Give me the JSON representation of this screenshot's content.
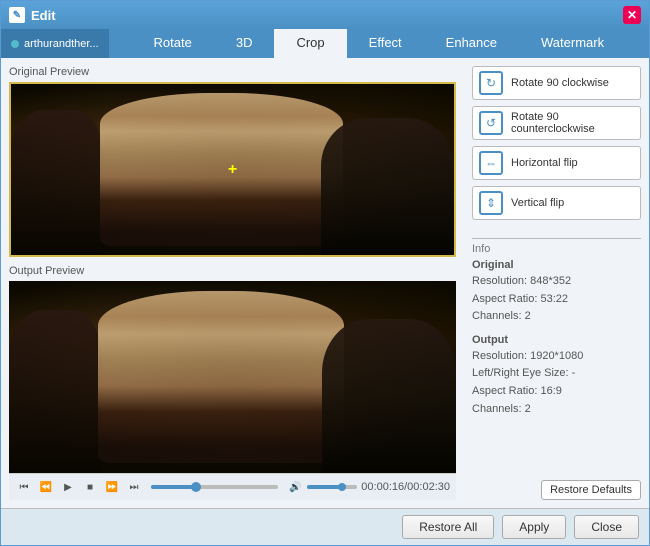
{
  "window": {
    "title": "Edit",
    "icon": "✎"
  },
  "tabs": {
    "file_tab": "arthurandther...",
    "items": [
      "Rotate",
      "3D",
      "Crop",
      "Effect",
      "Enhance",
      "Watermark"
    ],
    "active": "Crop"
  },
  "panels": {
    "original_label": "Original Preview",
    "output_label": "Output Preview"
  },
  "actions": [
    {
      "id": "rotate-cw",
      "icon": "↻",
      "label": "Rotate 90 clockwise"
    },
    {
      "id": "rotate-ccw",
      "icon": "↺",
      "label": "Rotate 90 counterclockwise"
    },
    {
      "id": "flip-h",
      "icon": "⇔",
      "label": "Horizontal flip"
    },
    {
      "id": "flip-v",
      "icon": "⇕",
      "label": "Vertical flip"
    }
  ],
  "info": {
    "section_label": "Info",
    "original_label": "Original",
    "original_resolution": "Resolution: 848*352",
    "original_aspect": "Aspect Ratio: 53:22",
    "original_channels": "Channels: 2",
    "output_label": "Output",
    "output_resolution": "Resolution: 1920*1080",
    "output_lr_size": "Left/Right Eye Size: -",
    "output_aspect": "Aspect Ratio: 16:9",
    "output_channels": "Channels: 2"
  },
  "controls": {
    "time_display": "00:00:16/00:02:30",
    "restore_defaults_label": "Restore Defaults"
  },
  "bottom": {
    "restore_all_label": "Restore All",
    "apply_label": "Apply",
    "close_label": "Close"
  }
}
